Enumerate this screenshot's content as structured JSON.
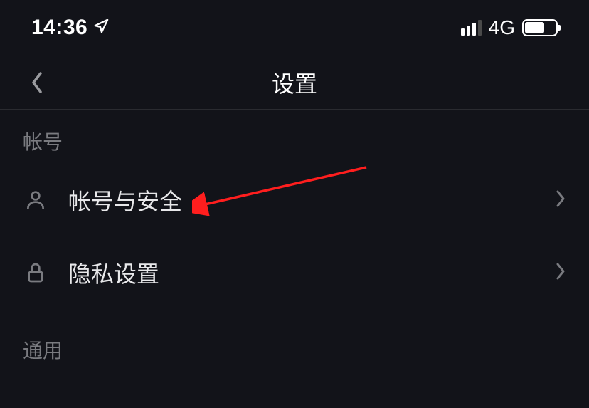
{
  "status_bar": {
    "time": "14:36",
    "network_label": "4G"
  },
  "header": {
    "title": "设置"
  },
  "sections": {
    "account": {
      "header": "帐号",
      "items": [
        {
          "label": "帐号与安全"
        },
        {
          "label": "隐私设置"
        }
      ]
    },
    "general": {
      "header": "通用"
    }
  }
}
